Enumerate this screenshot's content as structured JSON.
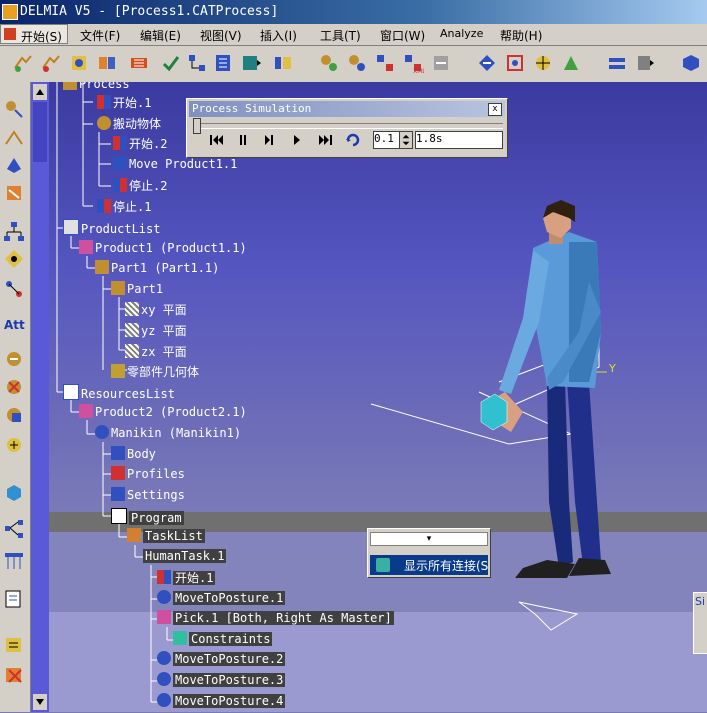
{
  "window": {
    "title": "DELMIA V5 - [Process1.CATProcess]"
  },
  "menu": {
    "start": "开始(S)",
    "items": [
      "文件(F)",
      "编辑(E)",
      "视图(V)",
      "插入(I)",
      "工具(T)",
      "窗口(W)",
      "Analyze",
      "帮助(H)"
    ]
  },
  "left_toolbar": {
    "att_label": "Att"
  },
  "tree": [
    {
      "label": "Process",
      "style": "normal"
    },
    {
      "label": "开始.1",
      "style": "normal"
    },
    {
      "label": "搬动物体",
      "style": "normal"
    },
    {
      "label": "开始.2",
      "style": "normal"
    },
    {
      "label": "Move Product1.1",
      "style": "normal"
    },
    {
      "label": "停止.2",
      "style": "normal"
    },
    {
      "label": "停止.1",
      "style": "normal"
    },
    {
      "label": "ProductList",
      "style": "normal"
    },
    {
      "label": "Product1 (Product1.1)",
      "style": "normal"
    },
    {
      "label": "Part1 (Part1.1)",
      "style": "normal"
    },
    {
      "label": "Part1",
      "style": "normal"
    },
    {
      "label": "xy 平面",
      "style": "normal"
    },
    {
      "label": "yz 平面",
      "style": "normal"
    },
    {
      "label": "zx 平面",
      "style": "normal"
    },
    {
      "label": "零部件几何体",
      "style": "normal"
    },
    {
      "label": "ResourcesList",
      "style": "normal"
    },
    {
      "label": "Product2 (Product2.1)",
      "style": "normal"
    },
    {
      "label": "Manikin (Manikin1)",
      "style": "normal"
    },
    {
      "label": "Body",
      "style": "normal"
    },
    {
      "label": "Profiles",
      "style": "normal"
    },
    {
      "label": "Settings",
      "style": "normal"
    },
    {
      "label": "Program",
      "style": "hl"
    },
    {
      "label": "TaskList",
      "style": "hl"
    },
    {
      "label": "HumanTask.1",
      "style": "hl"
    },
    {
      "label": "开始.1",
      "style": "hl"
    },
    {
      "label": "MoveToPosture.1",
      "style": "hl"
    },
    {
      "label": "Pick.1 [Both, Right As Master]",
      "style": "hl"
    },
    {
      "label": "Constraints",
      "style": "hl"
    },
    {
      "label": "MoveToPosture.2",
      "style": "hl"
    },
    {
      "label": "MoveToPosture.3",
      "style": "hl"
    },
    {
      "label": "MoveToPosture.4",
      "style": "hl"
    }
  ],
  "simulation": {
    "title": "Process Simulation",
    "close": "x",
    "step": "0.1",
    "time": "1.8s"
  },
  "context_menu": {
    "item": "显示所有连接(S"
  },
  "axis_label": "Y",
  "edge_panel_label": "Si"
}
